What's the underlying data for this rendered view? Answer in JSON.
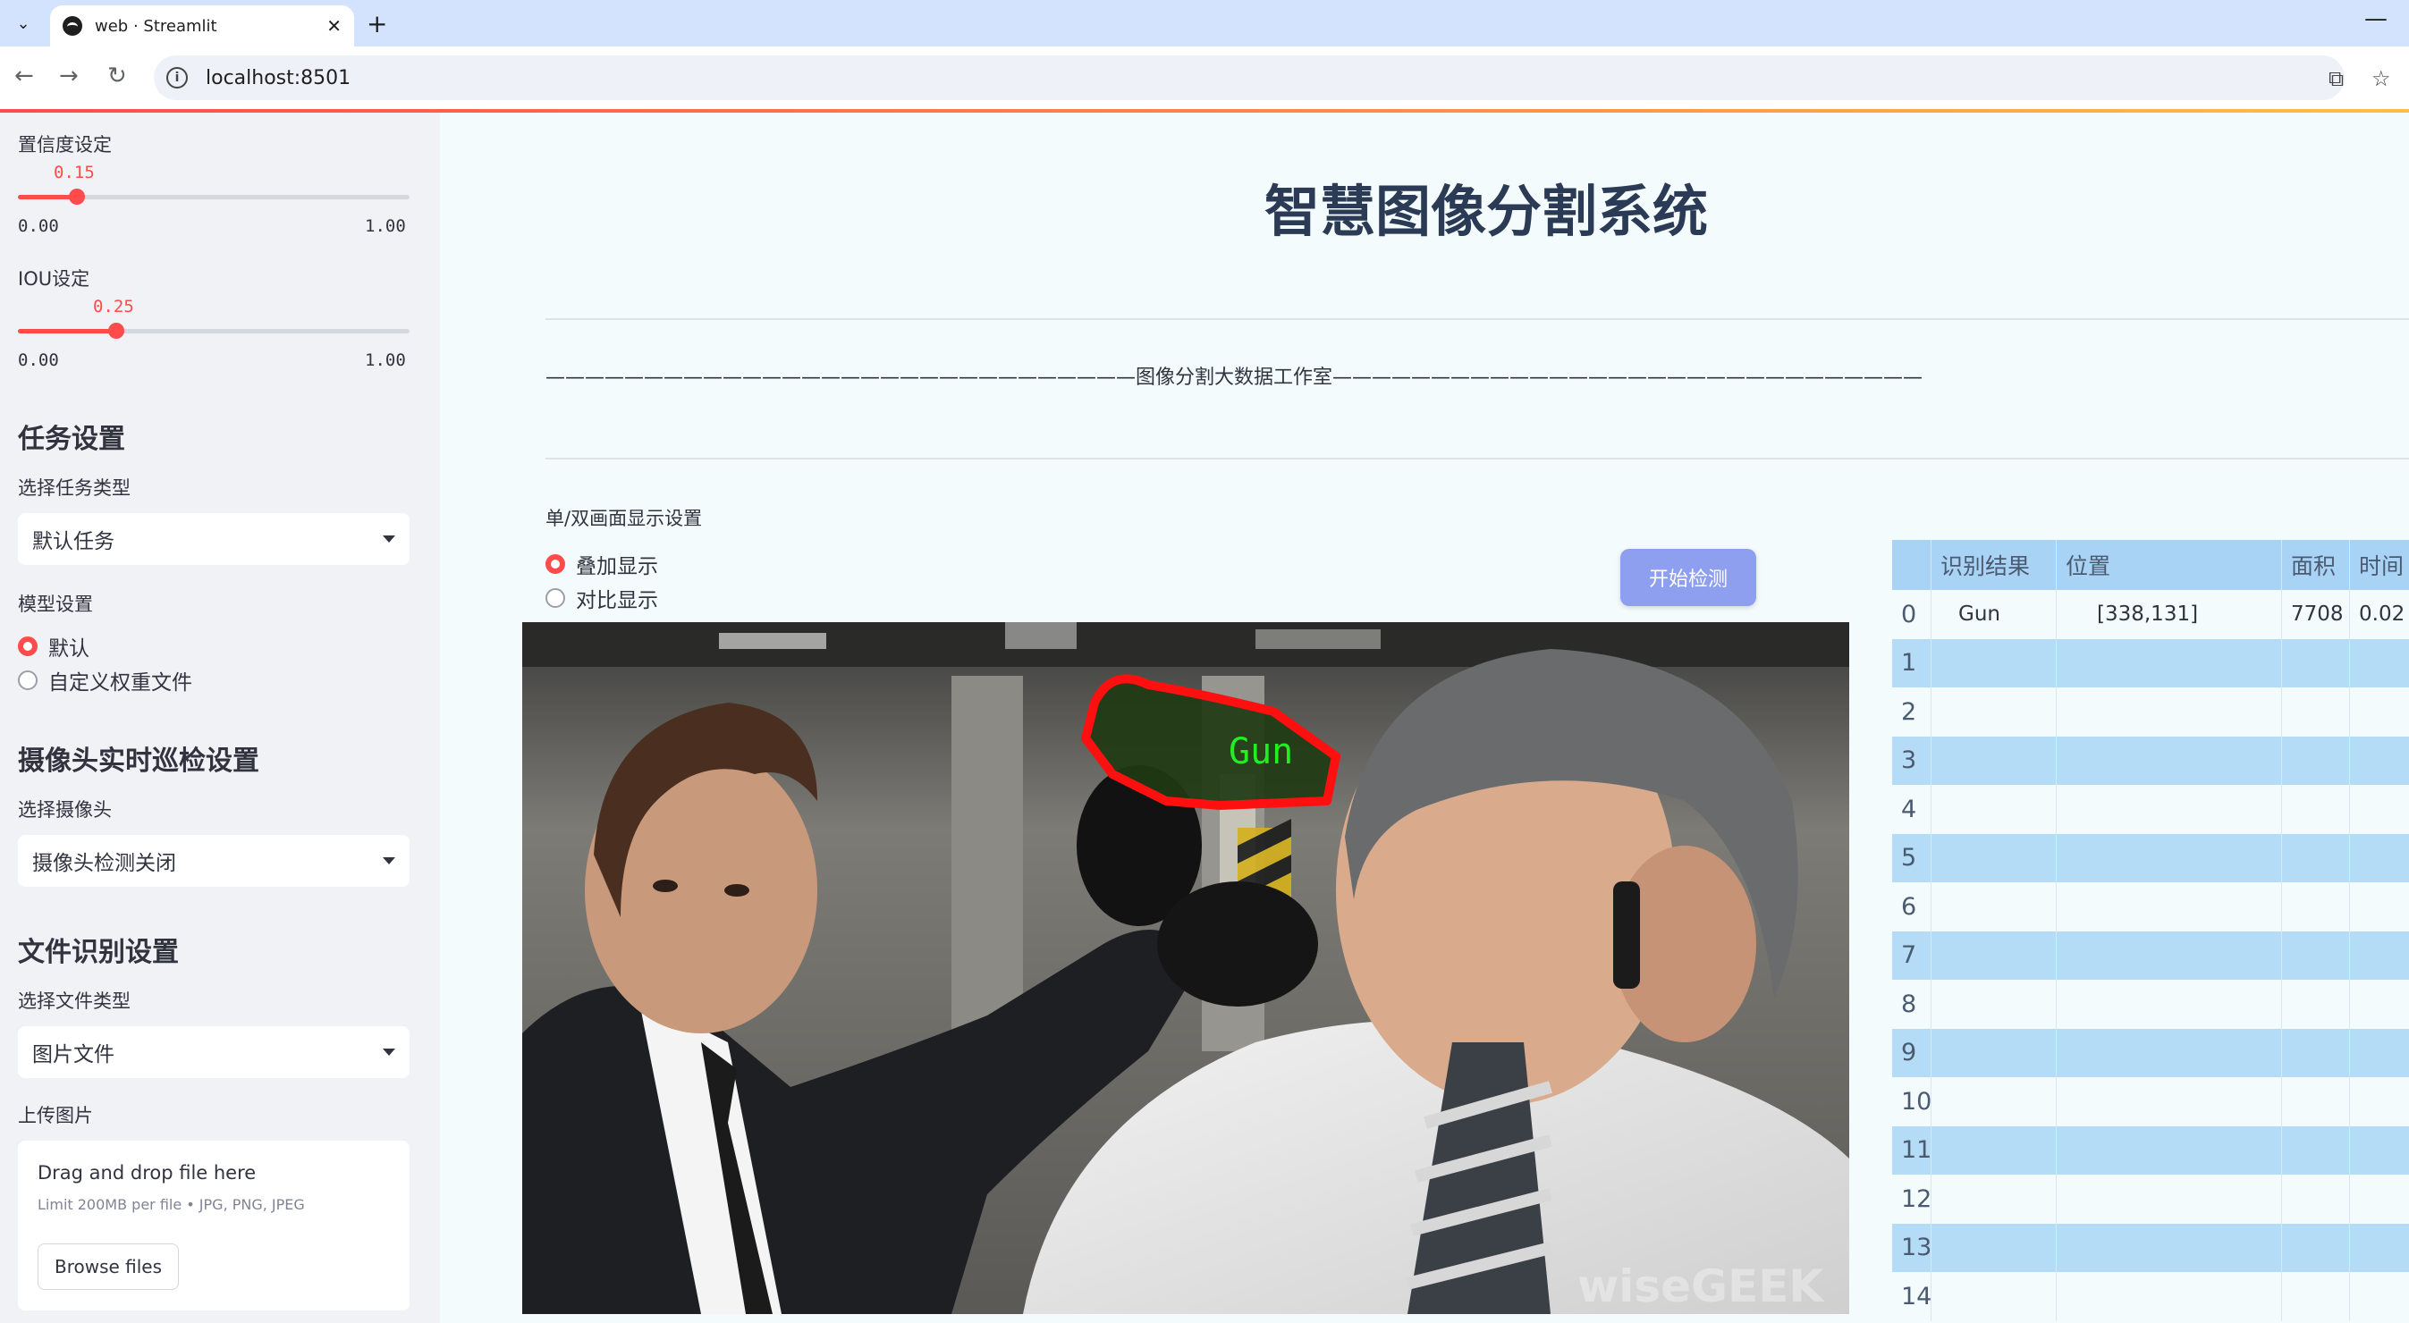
{
  "browser": {
    "tab_title": "web · Streamlit",
    "url": "localhost:8501",
    "tab_close": "✕",
    "new_tab": "+",
    "minimize": "—"
  },
  "sidebar": {
    "confidence": {
      "label": "置信度设定",
      "value_text": "0.15",
      "value": 0.15,
      "min": "0.00",
      "max": "1.00"
    },
    "iou": {
      "label": "IOU设定",
      "value_text": "0.25",
      "value": 0.25,
      "min": "0.00",
      "max": "1.00"
    },
    "task_settings": {
      "title": "任务设置",
      "select_label": "选择任务类型",
      "select_value": "默认任务"
    },
    "model_settings": {
      "label": "模型设置",
      "options": [
        "默认",
        "自定义权重文件"
      ],
      "selected": 0
    },
    "camera_settings": {
      "title": "摄像头实时巡检设置",
      "select_label": "选择摄像头",
      "select_value": "摄像头检测关闭"
    },
    "file_settings": {
      "title": "文件识别设置",
      "select_label": "选择文件类型",
      "select_value": "图片文件"
    },
    "upload": {
      "label": "上传图片",
      "drop_text": "Drag and drop file here",
      "limit_text": "Limit 200MB per file • JPG, PNG, JPEG",
      "browse_label": "Browse files"
    }
  },
  "main": {
    "title": "智慧图像分割系统",
    "divider_text": "——————————————————————————————图像分割大数据工作室——————————————————————————————",
    "display_mode": {
      "label": "单/双画面显示设置",
      "options": [
        "叠加显示",
        "对比显示"
      ],
      "selected": 0
    },
    "start_button": "开始检测",
    "detection_label": "Gun",
    "watermark": "wiseGEEK"
  },
  "results_table": {
    "columns": [
      "",
      "识别结果",
      "位置",
      "面积",
      "时间"
    ],
    "rows": [
      {
        "index": "0",
        "result": "Gun",
        "position": "[338,131]",
        "area": "7708",
        "time": "0.02"
      },
      {
        "index": "1",
        "result": "",
        "position": "",
        "area": "",
        "time": ""
      },
      {
        "index": "2",
        "result": "",
        "position": "",
        "area": "",
        "time": ""
      },
      {
        "index": "3",
        "result": "",
        "position": "",
        "area": "",
        "time": ""
      },
      {
        "index": "4",
        "result": "",
        "position": "",
        "area": "",
        "time": ""
      },
      {
        "index": "5",
        "result": "",
        "position": "",
        "area": "",
        "time": ""
      },
      {
        "index": "6",
        "result": "",
        "position": "",
        "area": "",
        "time": ""
      },
      {
        "index": "7",
        "result": "",
        "position": "",
        "area": "",
        "time": ""
      },
      {
        "index": "8",
        "result": "",
        "position": "",
        "area": "",
        "time": ""
      },
      {
        "index": "9",
        "result": "",
        "position": "",
        "area": "",
        "time": ""
      },
      {
        "index": "10",
        "result": "",
        "position": "",
        "area": "",
        "time": ""
      },
      {
        "index": "11",
        "result": "",
        "position": "",
        "area": "",
        "time": ""
      },
      {
        "index": "12",
        "result": "",
        "position": "",
        "area": "",
        "time": ""
      },
      {
        "index": "13",
        "result": "",
        "position": "",
        "area": "",
        "time": ""
      },
      {
        "index": "14",
        "result": "",
        "position": "",
        "area": "",
        "time": ""
      }
    ]
  },
  "colors": {
    "accent": "#ff4b4b",
    "sidebar_bg": "#f0f2f6",
    "main_bg": "#f3fbfd",
    "table_header": "#a9d3f5",
    "table_alt_row": "#b5dcf7",
    "start_button": "#8f9ff0",
    "mask_outline": "#ff0000",
    "mask_label": "#22ee22"
  }
}
